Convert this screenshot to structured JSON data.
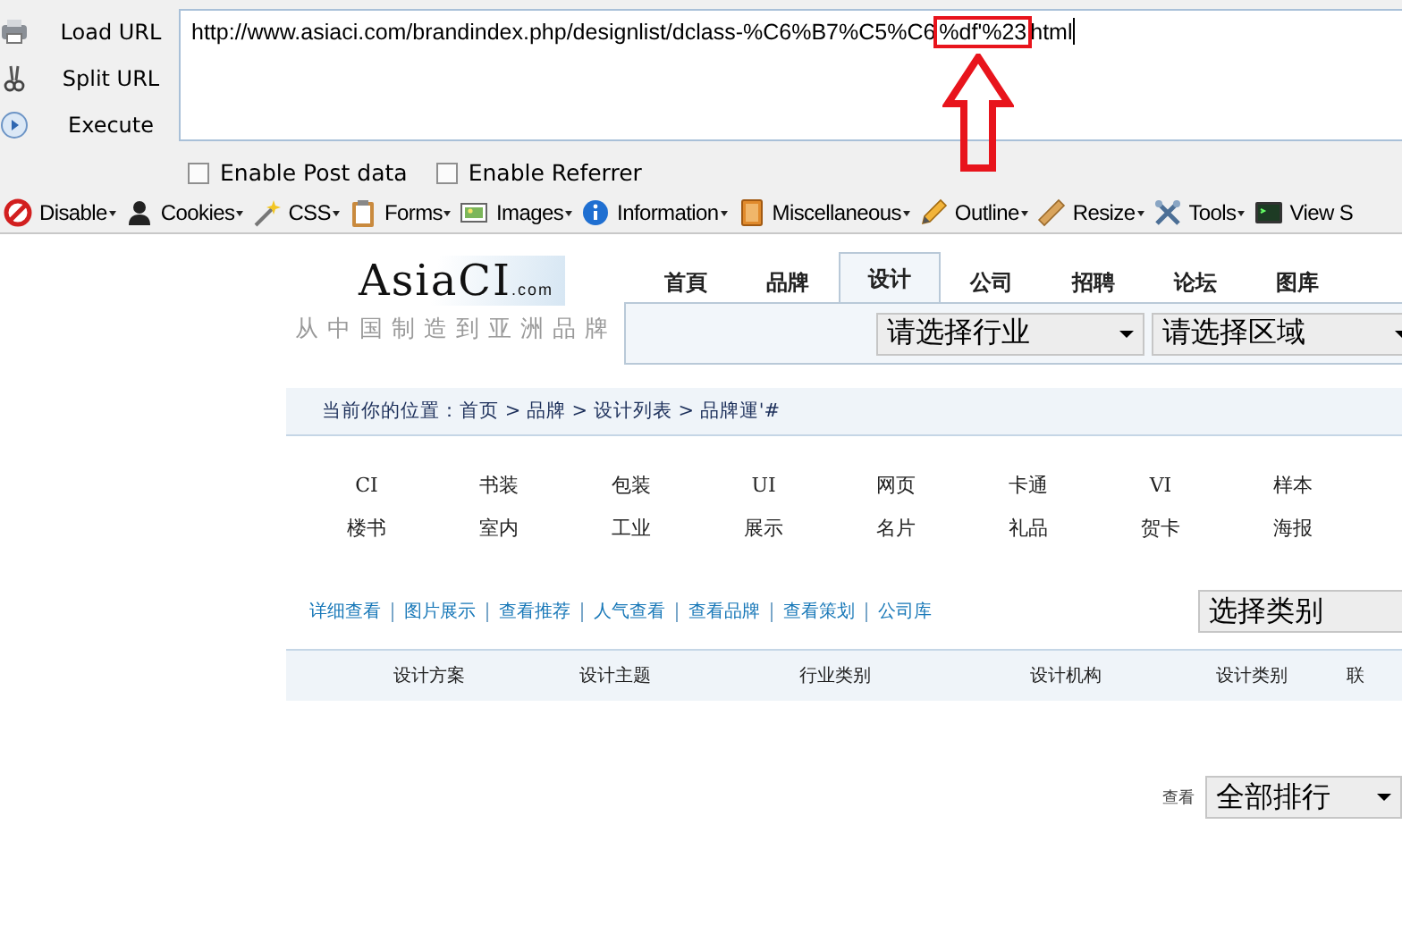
{
  "hackbar": {
    "actions": [
      {
        "label": "Load URL",
        "kind": "load"
      },
      {
        "label": "Split URL",
        "kind": "split"
      },
      {
        "label": "Execute",
        "kind": "execute"
      }
    ],
    "url": {
      "before": "http://www.asiaci.com/brandindex.php/designlist/dclass-%C6%B7%C5%C6",
      "highlight": "%df'%23",
      "after": "html"
    },
    "options": [
      {
        "label": "Enable Post data",
        "checked": false
      },
      {
        "label": "Enable Referrer",
        "checked": false
      }
    ]
  },
  "toolbar": [
    {
      "label": "Disable",
      "kind": "disable",
      "menu": true
    },
    {
      "label": "Cookies",
      "kind": "cookies",
      "menu": true
    },
    {
      "label": "CSS",
      "kind": "css",
      "menu": true
    },
    {
      "label": "Forms",
      "kind": "forms",
      "menu": true
    },
    {
      "label": "Images",
      "kind": "images",
      "menu": true
    },
    {
      "label": "Information",
      "kind": "information",
      "menu": true
    },
    {
      "label": "Miscellaneous",
      "kind": "misc",
      "menu": true
    },
    {
      "label": "Outline",
      "kind": "outline",
      "menu": true
    },
    {
      "label": "Resize",
      "kind": "resize",
      "menu": true
    },
    {
      "label": "Tools",
      "kind": "tools",
      "menu": true
    },
    {
      "label": "View S",
      "kind": "source",
      "menu": false
    }
  ],
  "site": {
    "logo": {
      "name": "AsiaCI",
      "suffix": ".com",
      "slogan": "从中国制造到亚洲品牌"
    },
    "nav": [
      {
        "label": "首頁",
        "selected": false
      },
      {
        "label": "品牌",
        "selected": false
      },
      {
        "label": "设计",
        "selected": true
      },
      {
        "label": "公司",
        "selected": false
      },
      {
        "label": "招聘",
        "selected": false
      },
      {
        "label": "论坛",
        "selected": false
      },
      {
        "label": "图库",
        "selected": false
      }
    ],
    "filters": [
      "请选择行业",
      "请选择区域"
    ],
    "breadcrumb": "当前你的位置：首页 > 品牌 > 设计列表 > 品牌運'#",
    "categories": [
      "CI",
      "书装",
      "包装",
      "UI",
      "网页",
      "卡通",
      "VI",
      "样本",
      "楼书",
      "室内",
      "工业",
      "展示",
      "名片",
      "礼品",
      "贺卡",
      "海报"
    ],
    "links": [
      "详细查看",
      "图片展示",
      "查看推荐",
      "人气查看",
      "查看品牌",
      "查看策划",
      "公司库"
    ],
    "category_select": "选择类别",
    "columns": [
      "设计方案",
      "设计主题",
      "行业类别",
      "设计机构",
      "设计类别",
      "联"
    ],
    "rank": {
      "label": "查看",
      "select": "全部排行"
    }
  }
}
